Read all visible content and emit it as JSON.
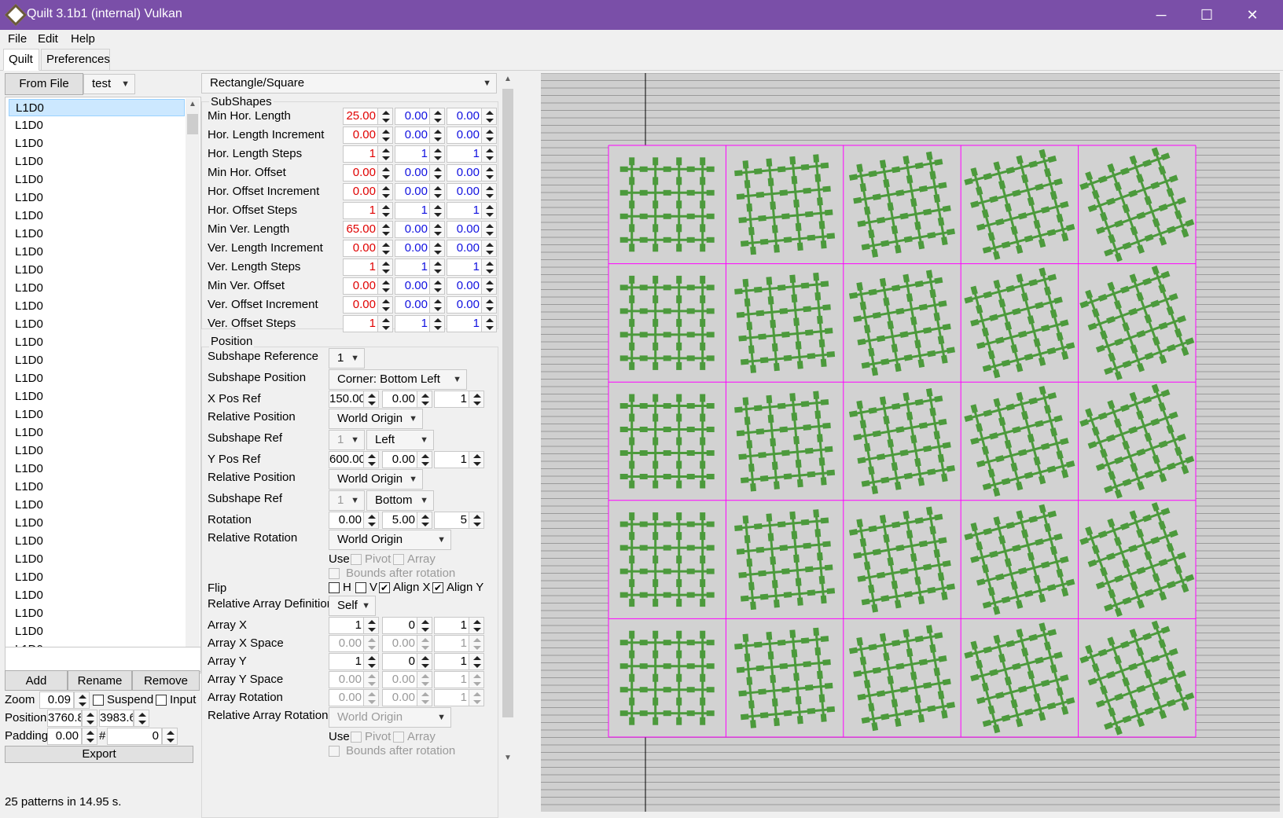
{
  "window": {
    "title": "Quilt 3.1b1 (internal) Vulkan",
    "minimize": "─",
    "maximize": "☐",
    "close": "✕"
  },
  "menu": [
    "File",
    "Edit",
    "Help"
  ],
  "tabs": [
    "Quilt",
    "Preferences"
  ],
  "left": {
    "from_file": "From File",
    "file_combo": "test",
    "list_items": [
      "L1D0",
      "L1D0",
      "L1D0",
      "L1D0",
      "L1D0",
      "L1D0",
      "L1D0",
      "L1D0",
      "L1D0",
      "L1D0",
      "L1D0",
      "L1D0",
      "L1D0",
      "L1D0",
      "L1D0",
      "L1D0",
      "L1D0",
      "L1D0",
      "L1D0",
      "L1D0",
      "L1D0",
      "L1D0",
      "L1D0",
      "L1D0",
      "L1D0",
      "L1D0",
      "L1D0",
      "L1D0",
      "L1D0",
      "L1D0",
      "L1D0",
      "L1D0"
    ],
    "add": "Add",
    "rename": "Rename",
    "remove": "Remove",
    "zoom_label": "Zoom",
    "zoom_value": "0.09",
    "suspend": "Suspend",
    "input": "Input",
    "position_label": "Position",
    "pos_x": "3760.8",
    "pos_y": "3983.6",
    "padding_label": "Padding",
    "padding_value": "0.00",
    "hash": "#",
    "hash_value": "0",
    "export": "Export",
    "status": "25 patterns in 14.95 s."
  },
  "shape": {
    "type": "Rectangle/Square"
  },
  "subshapes": {
    "title": "SubShapes",
    "rows": [
      {
        "label": "Min Hor. Length",
        "v": [
          "25.00",
          "0.00",
          "0.00"
        ]
      },
      {
        "label": "Hor. Length Increment",
        "v": [
          "0.00",
          "0.00",
          "0.00"
        ]
      },
      {
        "label": "Hor. Length Steps",
        "v": [
          "1",
          "1",
          "1"
        ]
      },
      {
        "label": "Min Hor. Offset",
        "v": [
          "0.00",
          "0.00",
          "0.00"
        ]
      },
      {
        "label": "Hor. Offset Increment",
        "v": [
          "0.00",
          "0.00",
          "0.00"
        ]
      },
      {
        "label": "Hor. Offset Steps",
        "v": [
          "1",
          "1",
          "1"
        ]
      },
      {
        "label": "Min Ver. Length",
        "v": [
          "65.00",
          "0.00",
          "0.00"
        ]
      },
      {
        "label": "Ver. Length Increment",
        "v": [
          "0.00",
          "0.00",
          "0.00"
        ]
      },
      {
        "label": "Ver. Length Steps",
        "v": [
          "1",
          "1",
          "1"
        ]
      },
      {
        "label": "Min Ver. Offset",
        "v": [
          "0.00",
          "0.00",
          "0.00"
        ]
      },
      {
        "label": "Ver. Offset Increment",
        "v": [
          "0.00",
          "0.00",
          "0.00"
        ]
      },
      {
        "label": "Ver. Offset Steps",
        "v": [
          "1",
          "1",
          "1"
        ]
      }
    ]
  },
  "position": {
    "title": "Position",
    "subshape_reference": "Subshape Reference",
    "subshape_reference_val": "1",
    "subshape_position": "Subshape Position",
    "subshape_position_val": "Corner: Bottom Left",
    "xposref": "X Pos Ref",
    "xposref_v": [
      "150.00",
      "0.00",
      "1"
    ],
    "relpos": "Relative Position",
    "relpos_val": "World Origin",
    "subshaperef": "Subshape Ref",
    "subshaperef_a": "1",
    "subshaperef_b": "Left",
    "yposref": "Y Pos Ref",
    "yposref_v": [
      "600.00",
      "0.00",
      "1"
    ],
    "relpos2_val": "World Origin",
    "subshaperef2_a": "1",
    "subshaperef2_b": "Bottom",
    "rotation": "Rotation",
    "rotation_v": [
      "0.00",
      "5.00",
      "5"
    ],
    "relrot": "Relative Rotation",
    "relrot_val": "World Origin",
    "use": "Use",
    "pivot": "Pivot",
    "array": "Array",
    "bounds": "Bounds after rotation",
    "flip": "Flip",
    "h": "H",
    "v": "V",
    "alignx": "Align X",
    "aligny": "Align Y",
    "rad": "Relative Array Definition",
    "rad_val": "Self",
    "arrayx": "Array X",
    "arrayx_v": [
      "1",
      "0",
      "1"
    ],
    "arrayxs": "Array X Space",
    "arrayxs_v": [
      "0.00",
      "0.00",
      "1"
    ],
    "arrayy": "Array Y",
    "arrayy_v": [
      "1",
      "0",
      "1"
    ],
    "arrayys": "Array Y Space",
    "arrayys_v": [
      "0.00",
      "0.00",
      "1"
    ],
    "arrayrot": "Array Rotation",
    "arrayrot_v": [
      "0.00",
      "0.00",
      "1"
    ],
    "rar": "Relative Array Rotation",
    "rar_val": "World Origin"
  },
  "colors": {
    "title": "#7a4fa8",
    "pattern": "#4c9a3c",
    "grid": "#ff00ff"
  }
}
